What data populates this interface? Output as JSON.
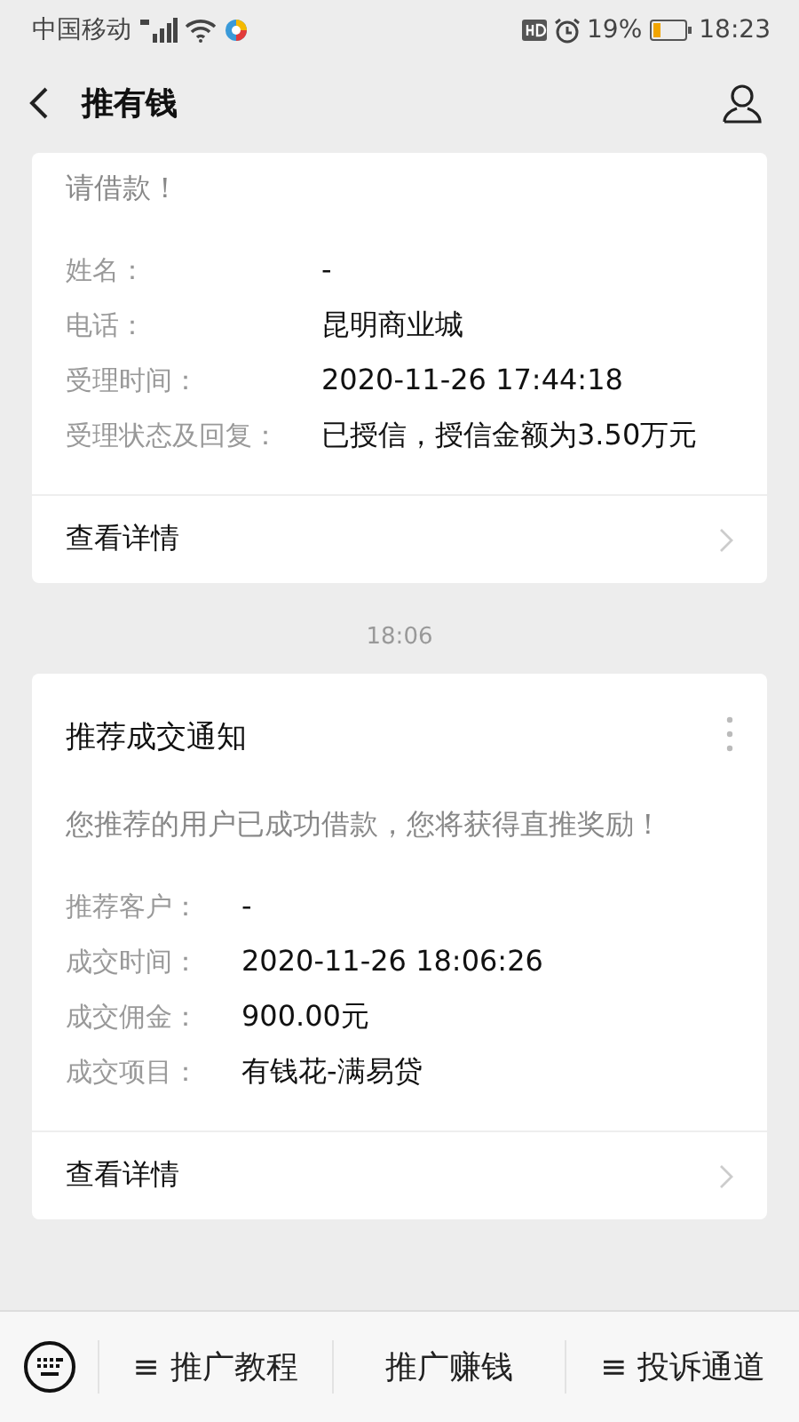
{
  "status_bar": {
    "carrier": "中国移动",
    "battery": "19%",
    "time": "18:23"
  },
  "nav": {
    "title": "推有钱"
  },
  "messages": [
    {
      "kind": "card",
      "intro": "请借款！",
      "fields": [
        {
          "label": "姓名：",
          "value": "-"
        },
        {
          "label": "电话：",
          "value": "昆明商业城"
        },
        {
          "label": "受理时间：",
          "value": "2020-11-26 17:44:18"
        },
        {
          "label": "受理状态及回复：",
          "value": "已授信，授信金额为3.50万元"
        }
      ],
      "link": "查看详情"
    },
    {
      "kind": "time",
      "text": "18:06"
    },
    {
      "kind": "card",
      "title": "推荐成交通知",
      "intro": "您推荐的用户已成功借款，您将获得直推奖励！",
      "fields": [
        {
          "label": "推荐客户：",
          "value": "-"
        },
        {
          "label": "成交时间：",
          "value": "2020-11-26 18:06:26"
        },
        {
          "label": "成交佣金：",
          "value": "900.00元"
        },
        {
          "label": "成交项目：",
          "value": "有钱花-满易贷"
        }
      ],
      "link": "查看详情"
    }
  ],
  "menu": [
    {
      "label": "推广教程",
      "glyph": "≡"
    },
    {
      "label": "推广赚钱"
    },
    {
      "label": "投诉通道",
      "glyph": "≡"
    }
  ]
}
